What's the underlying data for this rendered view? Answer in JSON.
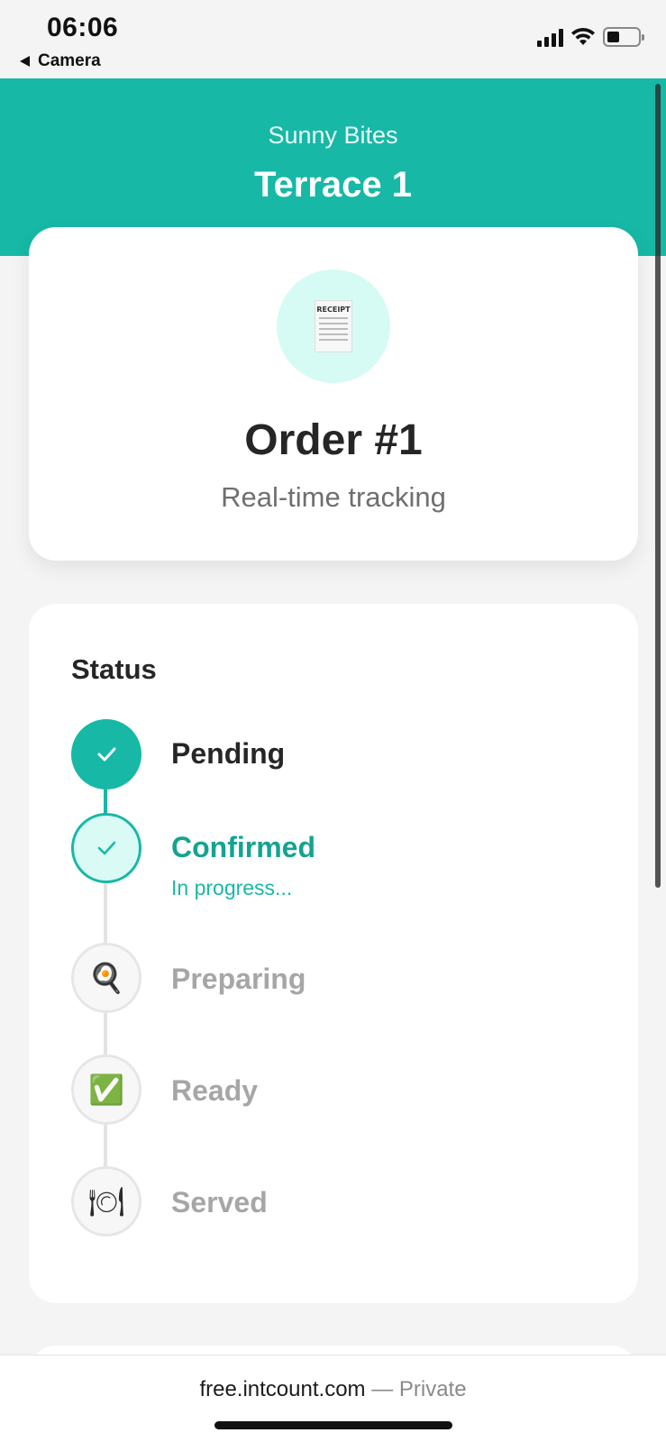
{
  "status_bar": {
    "time": "06:06",
    "back_label": "Camera"
  },
  "header": {
    "restaurant": "Sunny Bites",
    "table": "Terrace 1"
  },
  "order": {
    "title": "Order #1",
    "subtitle": "Real-time tracking",
    "icon": "receipt-icon",
    "receipt_text": "RECEIPT"
  },
  "status": {
    "heading": "Status",
    "steps": [
      {
        "label": "Pending",
        "state": "done",
        "icon": "check-icon"
      },
      {
        "label": "Confirmed",
        "state": "current",
        "icon": "check-icon",
        "progress": "In progress..."
      },
      {
        "label": "Preparing",
        "state": "todo",
        "icon": "frying-pan-icon",
        "glyph": "🍳"
      },
      {
        "label": "Ready",
        "state": "todo",
        "icon": "check-box-icon",
        "glyph": "✅"
      },
      {
        "label": "Served",
        "state": "todo",
        "icon": "plate-cutlery-icon",
        "glyph": "🍽"
      }
    ]
  },
  "browser": {
    "host": "free.intcount.com",
    "privacy": " — Private"
  },
  "colors": {
    "accent": "#17b8a6",
    "accent_light": "#d9faf5",
    "background": "#f4f4f5"
  }
}
